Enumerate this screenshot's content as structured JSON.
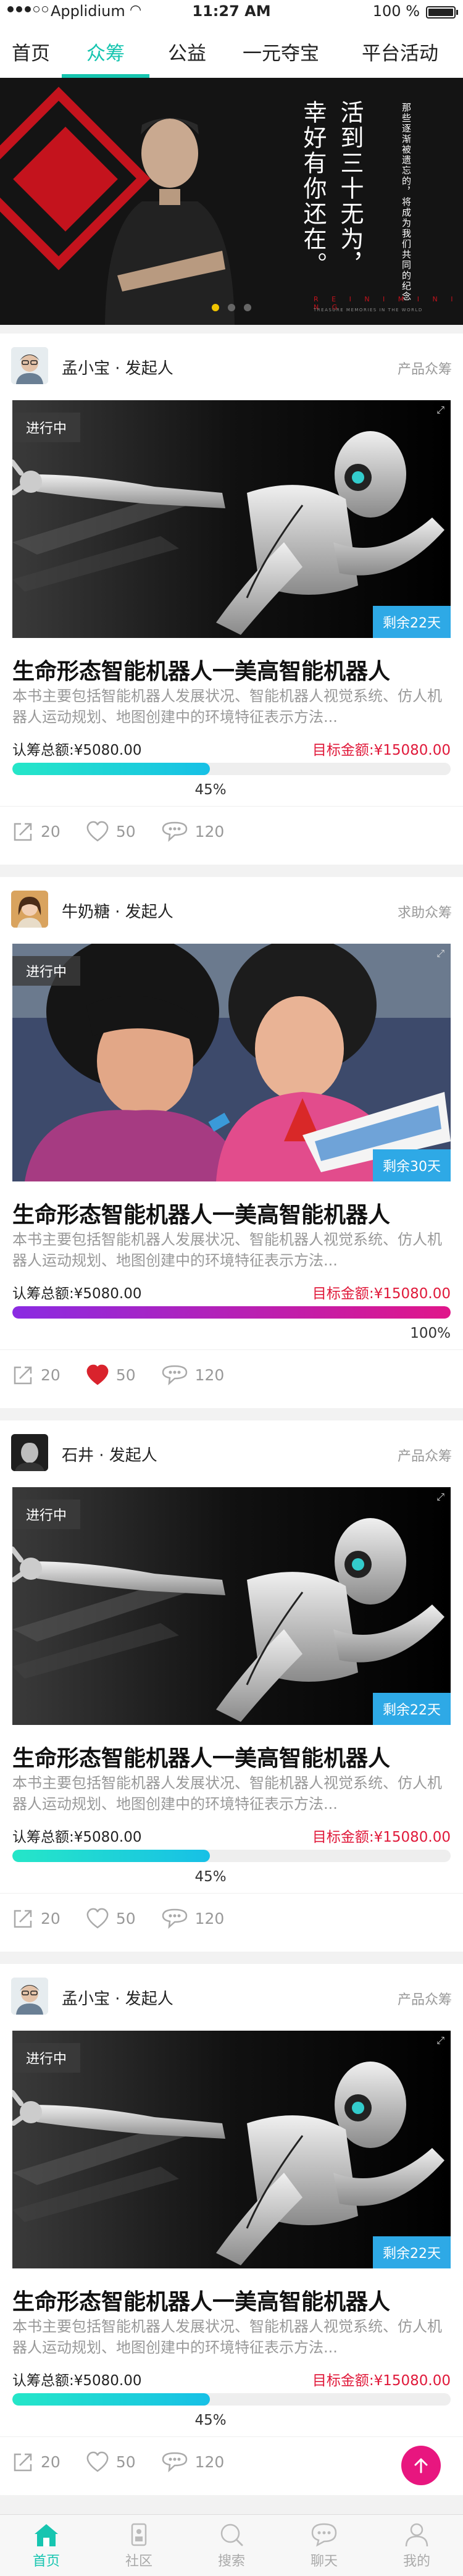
{
  "status": {
    "carrier": "Applidium",
    "time": "11:27 AM",
    "battery": "100 %"
  },
  "nav": {
    "tabs": [
      "首页",
      "众筹",
      "公益",
      "一元夺宝",
      "平台活动"
    ],
    "active": 1
  },
  "banner": {
    "main_line1": "活到三十无为，",
    "main_line2": "幸好有你还在。",
    "side_text": "那些逐渐被遗忘的，将成为我们共同的纪念",
    "caption": "R E I N I M I N I N G",
    "caption_small": "TREASURE MEMORIES IN THE WORLD",
    "active_dot": 0,
    "dot_count": 3
  },
  "cards": [
    {
      "name": "孟小宝 · 发起人",
      "type": "产品众筹",
      "status": "进行中",
      "remaining": "剩余22天",
      "title": "生命形态智能机器人一美高智能机器人",
      "desc": "本书主要包括智能机器人发展状况、智能机器人视觉系统、仿人机器人运动规划、地图创建中的环境特征表示方法...",
      "total": "认筹总额:¥5080.00",
      "target": "目标金额:¥15080.00",
      "percent": "45%",
      "progress": 0.45,
      "bar_color": "#1fd5c8",
      "share": "20",
      "likes": "50",
      "comments": "120",
      "liked": false,
      "image": "robot",
      "avatar": "man"
    },
    {
      "name": "牛奶糖 · 发起人",
      "type": "求助众筹",
      "status": "进行中",
      "remaining": "剩余30天",
      "title": "生命形态智能机器人一美高智能机器人",
      "desc": "本书主要包括智能机器人发展状况、智能机器人视觉系统、仿人机器人运动规划、地图创建中的环境特征表示方法...",
      "total": "认筹总额:¥5080.00",
      "target": "目标金额:¥15080.00",
      "percent": "100%",
      "progress": 1.0,
      "bar_color": "#d31aa6",
      "share": "20",
      "likes": "50",
      "comments": "120",
      "liked": true,
      "image": "girls",
      "avatar": "woman"
    },
    {
      "name": "石井 · 发起人",
      "type": "产品众筹",
      "status": "进行中",
      "remaining": "剩余22天",
      "title": "生命形态智能机器人一美高智能机器人",
      "desc": "本书主要包括智能机器人发展状况、智能机器人视觉系统、仿人机器人运动规划、地图创建中的环境特征表示方法...",
      "total": "认筹总额:¥5080.00",
      "target": "目标金额:¥15080.00",
      "percent": "45%",
      "progress": 0.45,
      "bar_color": "#1fd5c8",
      "share": "20",
      "likes": "50",
      "comments": "120",
      "liked": false,
      "image": "robot",
      "avatar": "dark"
    },
    {
      "name": "孟小宝 · 发起人",
      "type": "产品众筹",
      "status": "进行中",
      "remaining": "剩余22天",
      "title": "生命形态智能机器人一美高智能机器人",
      "desc": "本书主要包括智能机器人发展状况、智能机器人视觉系统、仿人机器人运动规划、地图创建中的环境特征表示方法...",
      "total": "认筹总额:¥5080.00",
      "target": "目标金额:¥15080.00",
      "percent": "45%",
      "progress": 0.45,
      "bar_color": "#1fd5c8",
      "share": "20",
      "likes": "50",
      "comments": "120",
      "liked": false,
      "image": "robot",
      "avatar": "man"
    }
  ],
  "bottom_nav": {
    "items": [
      "首页",
      "社区",
      "搜索",
      "聊天",
      "我的"
    ],
    "icons": [
      "home-icon",
      "community-icon",
      "search-icon",
      "chat-icon",
      "profile-icon"
    ],
    "active": 0
  },
  "colors": {
    "accent": "#17c5b0",
    "danger": "#e0193a",
    "badge": "#2ea9e6",
    "fab": "#e8167f"
  }
}
